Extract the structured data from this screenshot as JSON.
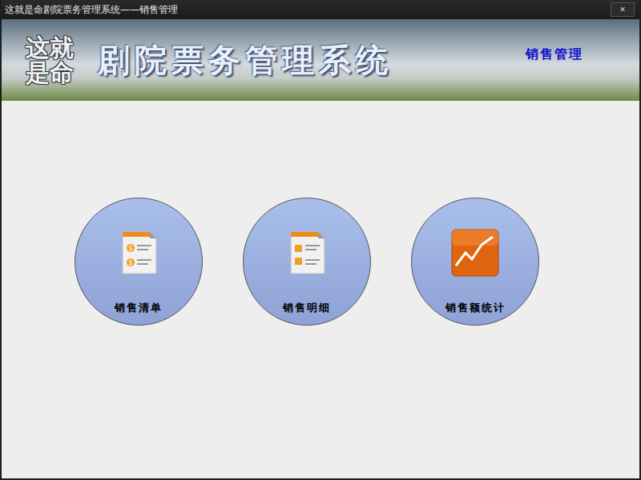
{
  "window": {
    "title": "这就是命剧院票务管理系统——销售管理",
    "close": "×"
  },
  "banner": {
    "logo": "这就是命",
    "title": "剧院票务管理系统",
    "section": "销售管理"
  },
  "buttons": [
    {
      "label": "销售清单",
      "kind": "list"
    },
    {
      "label": "销售明细",
      "kind": "detail"
    },
    {
      "label": "销售额统计",
      "kind": "chart"
    }
  ]
}
